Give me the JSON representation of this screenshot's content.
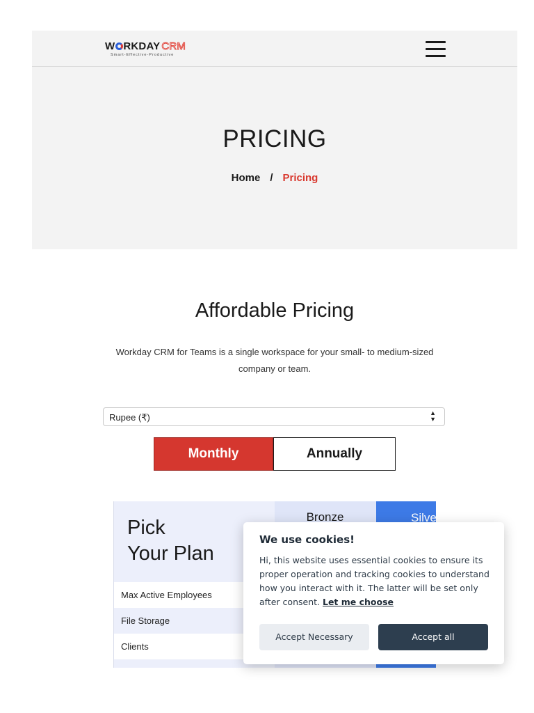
{
  "header": {
    "logo": {
      "word_main": "W",
      "word_rest": "RKDAY",
      "crm": "CRM",
      "tagline": "Smart-Effective-Productive"
    }
  },
  "hero": {
    "title": "PRICING",
    "breadcrumb": {
      "home": "Home",
      "separator": "/",
      "current": "Pricing"
    }
  },
  "section": {
    "title": "Affordable Pricing",
    "description": "Workday CRM for Teams is a single workspace for your small- to medium-sized company or team."
  },
  "currency_select": {
    "value": "Rupee (₹)"
  },
  "billing_toggle": {
    "monthly": "Monthly",
    "annually": "Annually",
    "selected": "Monthly"
  },
  "pricing_table": {
    "pick_line1": "Pick",
    "pick_line2": "Your Plan",
    "plans": [
      "Bronze",
      "Silve"
    ],
    "features": [
      "Max Active Employees",
      "File Storage",
      "Clients"
    ]
  },
  "cookie_banner": {
    "title": "We use cookies!",
    "text": "Hi, this website uses essential cookies to ensure its proper operation and tracking cookies to understand how you interact with it. The latter will be set only after consent.",
    "link": "Let me choose",
    "btn_necessary": "Accept Necessary",
    "btn_all": "Accept all"
  },
  "colors": {
    "accent_red": "#d5372f",
    "silver_blue": "#3d7ae6",
    "bronze_bg": "#dfe5f8",
    "cookie_primary": "#2d3e4f"
  }
}
